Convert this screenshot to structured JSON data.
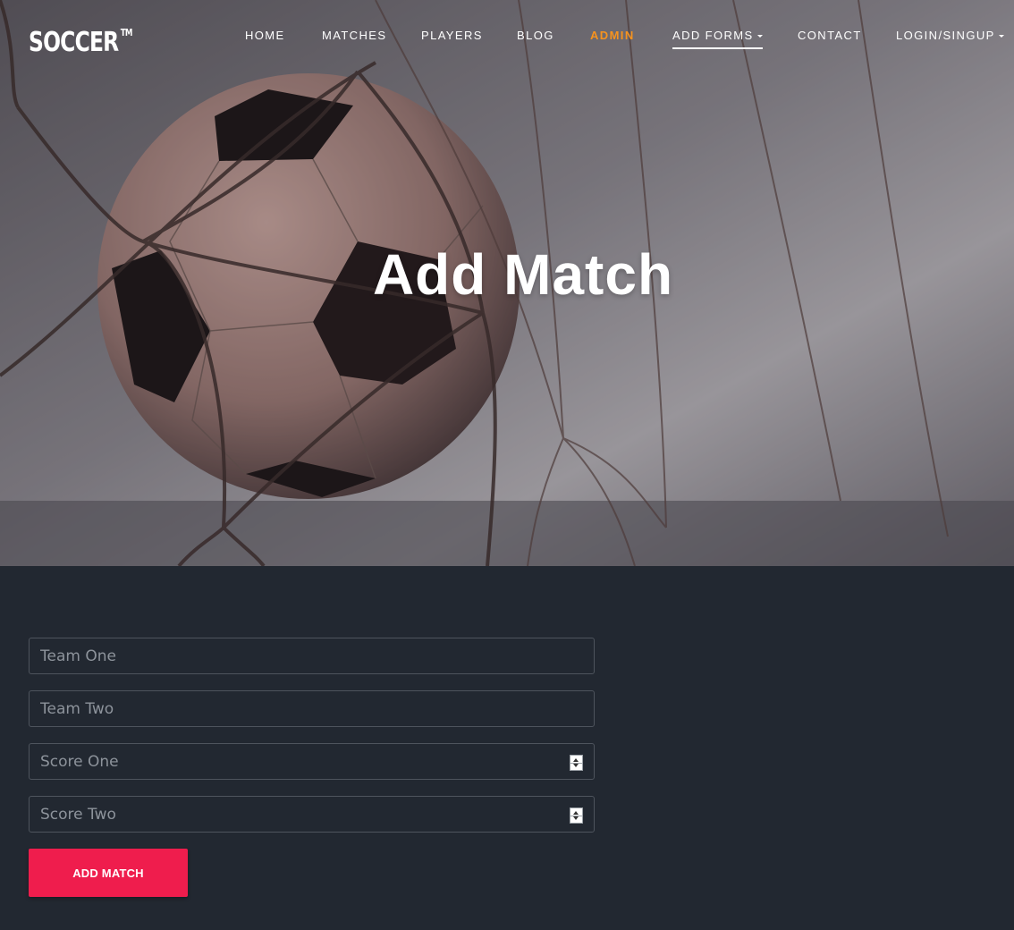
{
  "brand": {
    "name": "SOCCER",
    "trademark": "TM"
  },
  "nav": {
    "items": [
      {
        "label": "HOME"
      },
      {
        "label": "MATCHES"
      },
      {
        "label": "PLAYERS"
      },
      {
        "label": "BLOG"
      },
      {
        "label": "ADMIN",
        "state": "active",
        "color": "#f7931e"
      },
      {
        "label": "ADD FORMS",
        "dropdown": true,
        "state": "underlined"
      },
      {
        "label": "CONTACT"
      },
      {
        "label": "LOGIN/SINGUP",
        "dropdown": true
      }
    ]
  },
  "hero": {
    "title": "Add Match"
  },
  "form": {
    "team_one": {
      "placeholder": "Team One",
      "value": ""
    },
    "team_two": {
      "placeholder": "Team Two",
      "value": ""
    },
    "score_one": {
      "placeholder": "Score One",
      "value": ""
    },
    "score_two": {
      "placeholder": "Score Two",
      "value": ""
    },
    "submit_label": "ADD MATCH"
  },
  "colors": {
    "accent": "#ef1d4d",
    "admin_highlight": "#f7931e",
    "background": "#222831"
  }
}
